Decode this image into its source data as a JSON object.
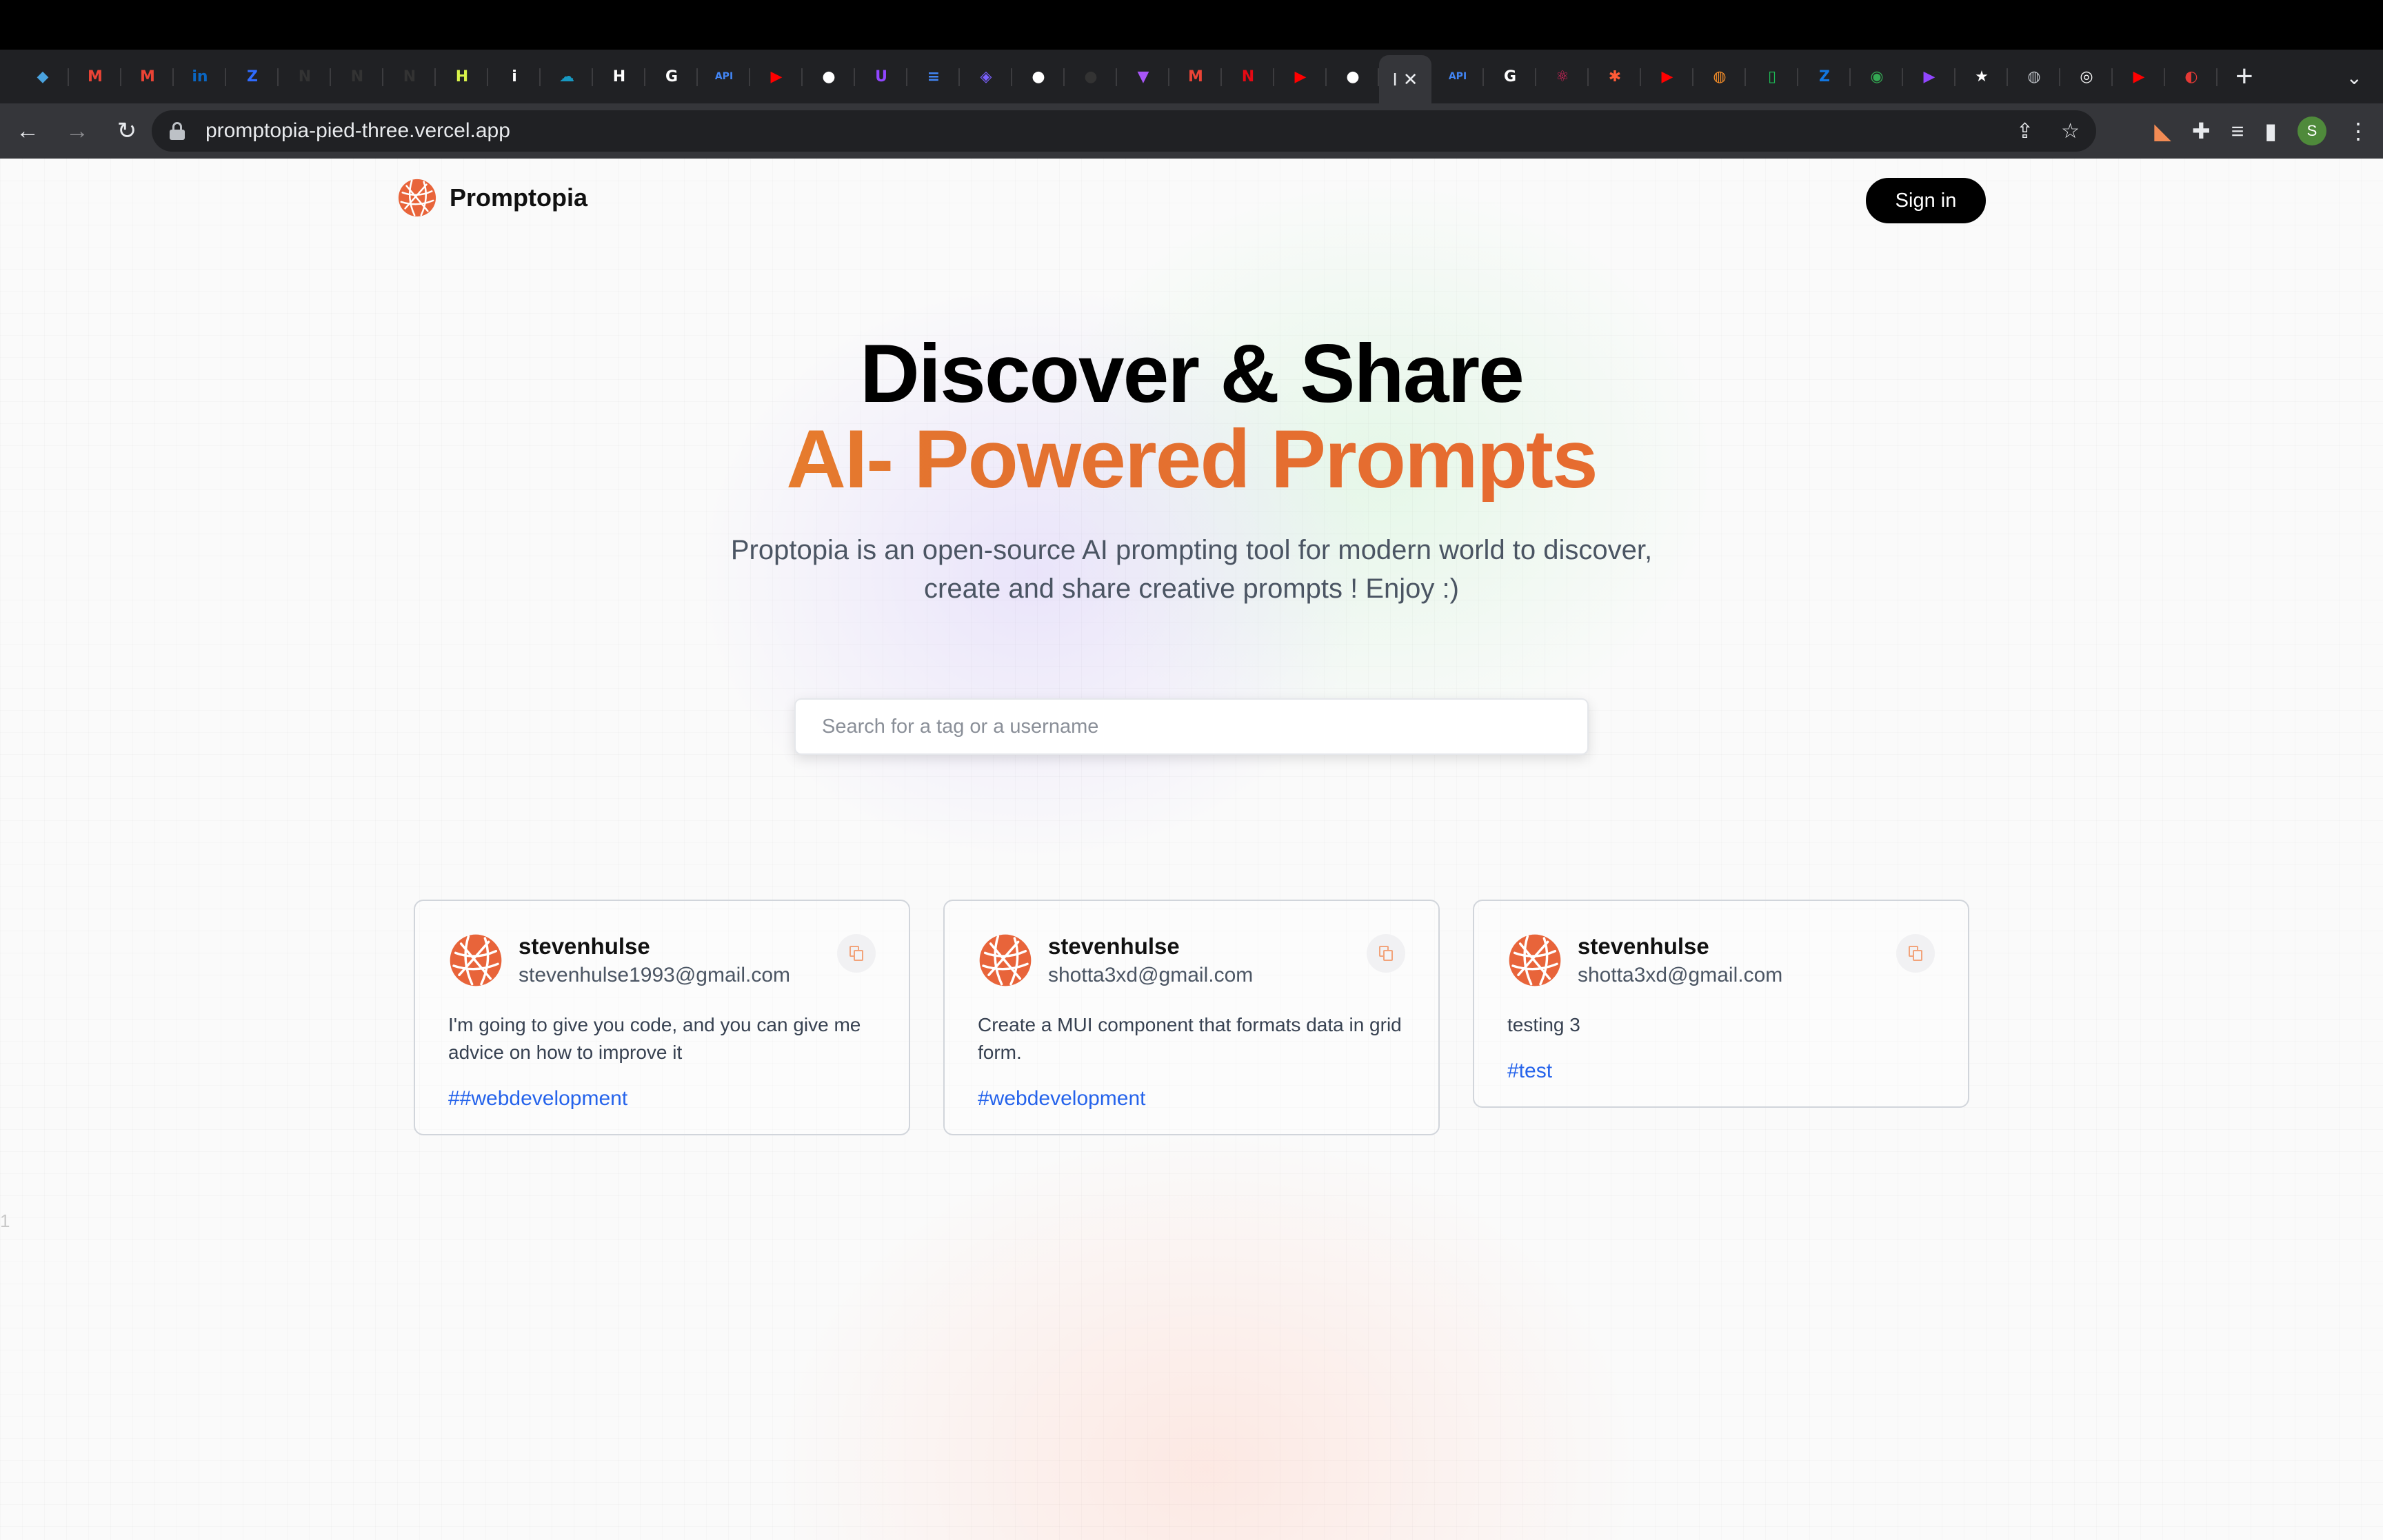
{
  "browser": {
    "tabs": [
      {
        "icon": "cube-icon",
        "color": "#4aa3df",
        "glyph": "◆"
      },
      {
        "icon": "gmail-icon",
        "color": "#ea4335",
        "glyph": "M"
      },
      {
        "icon": "gmail-icon",
        "color": "#ea4335",
        "glyph": "M"
      },
      {
        "icon": "linkedin-icon",
        "color": "#0a66c2",
        "glyph": "in"
      },
      {
        "icon": "zoho-icon",
        "color": "#2f6bff",
        "glyph": "Z"
      },
      {
        "icon": "nyc-doe-icon",
        "color": "#333333",
        "glyph": "N"
      },
      {
        "icon": "nyc-doe-icon",
        "color": "#333333",
        "glyph": "N"
      },
      {
        "icon": "nyc-doe-icon",
        "color": "#333333",
        "glyph": "N"
      },
      {
        "icon": "handshake-icon",
        "color": "#d8f24a",
        "glyph": "H"
      },
      {
        "icon": "info-icon",
        "color": "#ffffff",
        "glyph": "i"
      },
      {
        "icon": "salesforce-icon",
        "color": "#1798c1",
        "glyph": "☁"
      },
      {
        "icon": "hackerrank-icon",
        "color": "#ffffff",
        "glyph": "H"
      },
      {
        "icon": "google-icon",
        "color": "#ffffff",
        "glyph": "G"
      },
      {
        "icon": "api-icon",
        "color": "#4285f4",
        "glyph": "API"
      },
      {
        "icon": "youtube-icon",
        "color": "#ff0000",
        "glyph": "▶"
      },
      {
        "icon": "github-icon",
        "color": "#ffffff",
        "glyph": "●"
      },
      {
        "icon": "twitch-icon",
        "color": "#9146ff",
        "glyph": "U"
      },
      {
        "icon": "docs-icon",
        "color": "#4285f4",
        "glyph": "≡"
      },
      {
        "icon": "shield-icon",
        "color": "#7b61ff",
        "glyph": "◈"
      },
      {
        "icon": "github-icon",
        "color": "#ffffff",
        "glyph": "●"
      },
      {
        "icon": "github-icon",
        "color": "#333333",
        "glyph": "●"
      },
      {
        "icon": "vite-icon",
        "color": "#a855f7",
        "glyph": "▼"
      },
      {
        "icon": "gmail-icon",
        "color": "#ea4335",
        "glyph": "M"
      },
      {
        "icon": "netflix-icon",
        "color": "#e50914",
        "glyph": "N"
      },
      {
        "icon": "youtube-icon",
        "color": "#ff0000",
        "glyph": "▶"
      },
      {
        "icon": "github-icon",
        "color": "#ffffff",
        "glyph": "●"
      }
    ],
    "active_tab_label": "I",
    "tabs_after": [
      {
        "icon": "api-icon",
        "color": "#4285f4",
        "glyph": "API"
      },
      {
        "icon": "google-icon",
        "color": "#ffffff",
        "glyph": "G"
      },
      {
        "icon": "react-icon",
        "color": "#e0245e",
        "glyph": "⚛"
      },
      {
        "icon": "asterisk-icon",
        "color": "#ff5a36",
        "glyph": "✱"
      },
      {
        "icon": "youtube-icon",
        "color": "#ff0000",
        "glyph": "▶"
      },
      {
        "icon": "globe-orange-icon",
        "color": "#f28c28",
        "glyph": "◍"
      },
      {
        "icon": "phone-icon",
        "color": "#1db954",
        "glyph": "▯"
      },
      {
        "icon": "zillow-icon",
        "color": "#1277e1",
        "glyph": "Z"
      },
      {
        "icon": "maps-icon",
        "color": "#34a853",
        "glyph": "◉"
      },
      {
        "icon": "play-icon",
        "color": "#9146ff",
        "glyph": "▶"
      },
      {
        "icon": "star-icon",
        "color": "#ffffff",
        "glyph": "★"
      },
      {
        "icon": "globe-icon",
        "color": "#bdc1c6",
        "glyph": "◍"
      },
      {
        "icon": "chrome-icon",
        "color": "#ffffff",
        "glyph": "◎"
      },
      {
        "icon": "youtube-icon",
        "color": "#ff0000",
        "glyph": "▶"
      },
      {
        "icon": "pokeball-icon",
        "color": "#e53935",
        "glyph": "◐"
      }
    ],
    "url": "promptopia-pied-three.vercel.app",
    "profile_initial": "S"
  },
  "nav": {
    "brand": "Promptopia",
    "signin_label": "Sign in"
  },
  "hero": {
    "title_line1": "Discover & Share",
    "title_line2": "AI- Powered Prompts",
    "description": "Proptopia is an open-source AI prompting tool for modern world to discover, create and share creative prompts ! Enjoy :)"
  },
  "search": {
    "placeholder": "Search for a tag or a username",
    "value": ""
  },
  "cards": [
    {
      "username": "stevenhulse",
      "email": "stevenhulse1993@gmail.com",
      "prompt": "I'm going to give you code, and you can give me advice on how to improve it",
      "tag": "##webdevelopment"
    },
    {
      "username": "stevenhulse",
      "email": "shotta3xd@gmail.com",
      "prompt": "Create a MUI component that formats data in grid form.",
      "tag": "#webdevelopment"
    },
    {
      "username": "stevenhulse",
      "email": "shotta3xd@gmail.com",
      "prompt": "testing 3",
      "tag": "#test"
    }
  ],
  "page_line_number": "1",
  "colors": {
    "brand_orange": "#e66a30",
    "gradient_start": "#f5a524",
    "gradient_end": "#f1b130",
    "tag_blue": "#2563eb",
    "signin_bg": "#000000"
  }
}
